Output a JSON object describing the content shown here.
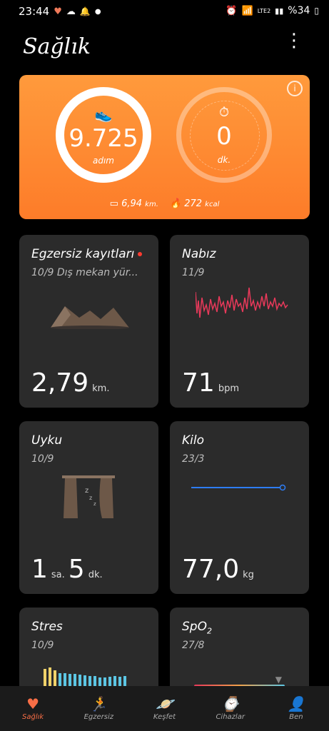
{
  "status_bar": {
    "time": "23:44",
    "battery": "%34",
    "network": "LTE2"
  },
  "header": {
    "title": "Sağlık"
  },
  "activity": {
    "steps": "9.725",
    "steps_label": "adım",
    "minutes": "0",
    "minutes_label": "dk.",
    "distance": "6,94",
    "distance_unit": "km.",
    "calories": "272",
    "calories_unit": "kcal"
  },
  "cards": {
    "exercise": {
      "title": "Egzersiz kayıtları",
      "subtitle": "10/9 Dış mekan yür...",
      "value": "2,79",
      "unit": "km."
    },
    "heart": {
      "title": "Nabız",
      "subtitle": "11/9",
      "value": "71",
      "unit": "bpm"
    },
    "sleep": {
      "title": "Uyku",
      "subtitle": "10/9",
      "hours": "1",
      "hours_unit": "sa.",
      "minutes": "5",
      "minutes_unit": "dk."
    },
    "weight": {
      "title": "Kilo",
      "subtitle": "23/3",
      "value": "77,0",
      "unit": "kg"
    },
    "stress": {
      "title": "Stres",
      "subtitle": "10/9"
    },
    "spo2": {
      "title": "SpO",
      "title_sub": "2",
      "subtitle": "27/8"
    }
  },
  "bottom_nav": {
    "items": [
      {
        "label": "Sağlık",
        "icon": "heart-pulse-icon"
      },
      {
        "label": "Egzersiz",
        "icon": "runner-icon"
      },
      {
        "label": "Keşfet",
        "icon": "planet-icon"
      },
      {
        "label": "Cihazlar",
        "icon": "watch-icon"
      },
      {
        "label": "Ben",
        "icon": "person-icon"
      }
    ]
  },
  "colors": {
    "accent": "#f86e46",
    "hero_top": "#ff9a3c",
    "hero_bottom": "#fd7c29",
    "card": "#2b2b2b",
    "heart_line": "#e8395a",
    "weight_line": "#2e7df6"
  }
}
